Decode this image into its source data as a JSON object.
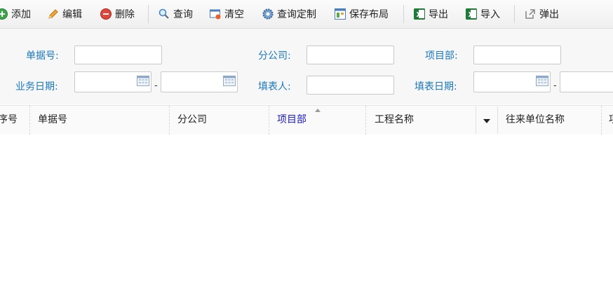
{
  "toolbar": {
    "add": "添加",
    "edit": "编辑",
    "delete": "删除",
    "query": "查询",
    "clear": "清空",
    "query_custom": "查询定制",
    "save_layout": "保存布局",
    "export": "导出",
    "import": "导入",
    "popup": "弹出"
  },
  "form": {
    "doc_no_label": "单据号:",
    "branch_label": "分公司:",
    "project_dept_label": "项目部:",
    "biz_date_label": "业务日期:",
    "filler_label": "填表人:",
    "fill_date_label": "填表日期:",
    "range_dash": "-"
  },
  "grid": {
    "columns": [
      "序号",
      "单据号",
      "分公司",
      "项目部",
      "工程名称",
      "往来单位名称",
      "项"
    ],
    "sorted_column": "项目部",
    "sorted_color": "#1a1ac8"
  },
  "colors": {
    "label": "#1a78c2",
    "excel_green": "#1f7a3a"
  }
}
